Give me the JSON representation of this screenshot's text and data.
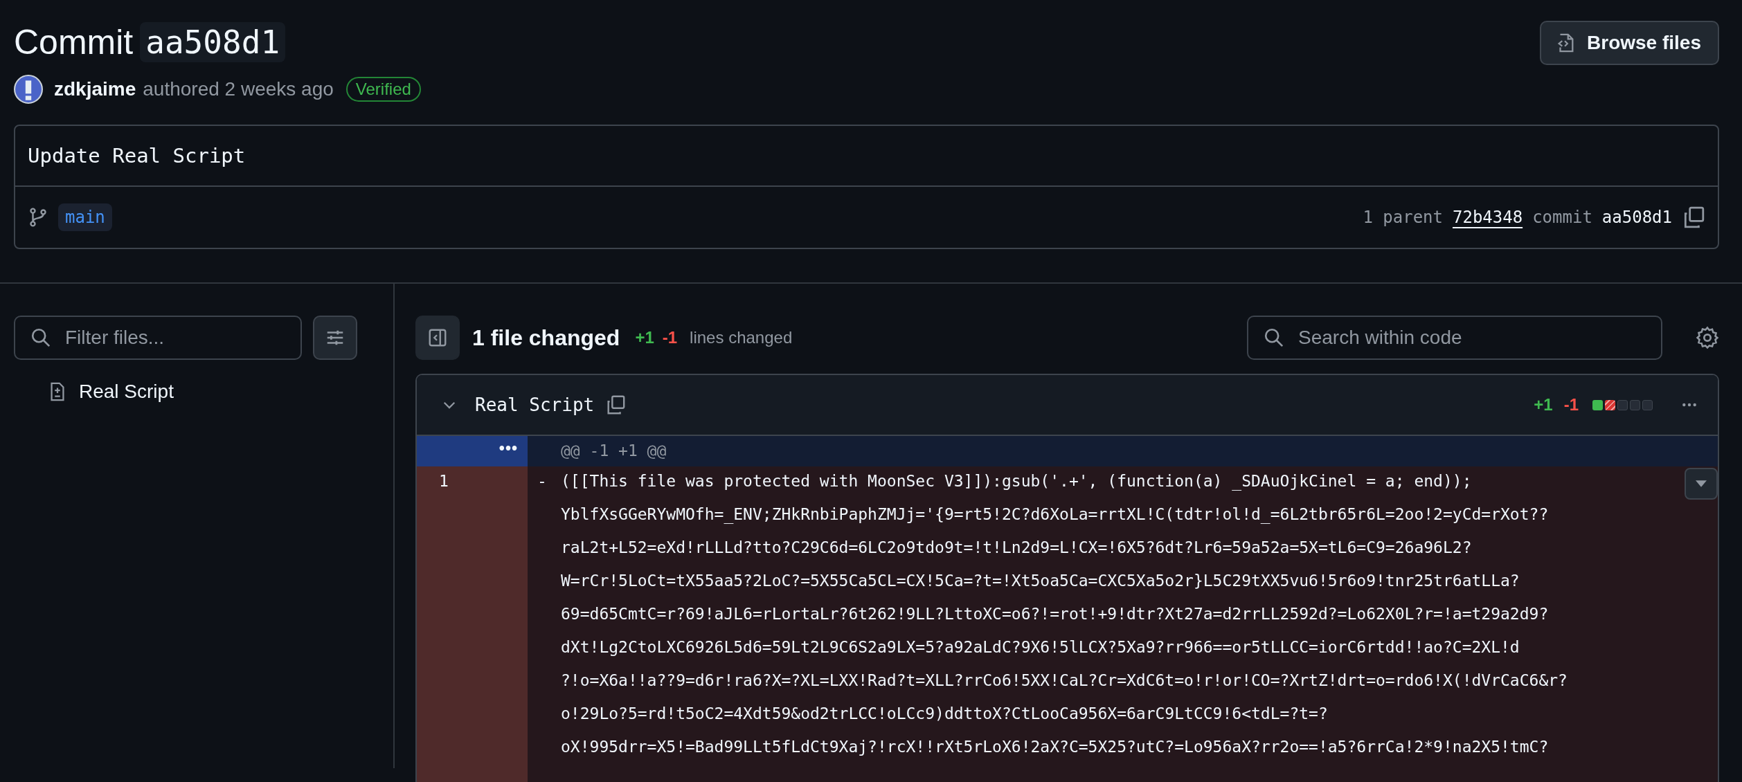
{
  "header": {
    "title": "Commit",
    "sha": "aa508d1",
    "browse_button": "Browse files"
  },
  "meta": {
    "author": "zdkjaime",
    "action": "authored 2 weeks ago",
    "badge": "Verified"
  },
  "message": {
    "title": "Update Real Script",
    "branch": "main",
    "parent_label": "1 parent",
    "parent_sha": "72b4348",
    "commit_label": "commit",
    "commit_sha": "aa508d1"
  },
  "sidebar": {
    "filter": {
      "placeholder": "Filter files..."
    },
    "files": [
      {
        "name": "Real Script",
        "selected": false
      }
    ]
  },
  "toolbar": {
    "summary": "1 file changed",
    "additions": "+1",
    "deletions": "-1",
    "suffix": "lines changed",
    "search": {
      "placeholder": "Search within code"
    }
  },
  "file": {
    "name": "Real Script",
    "additions": "+1",
    "deletions": "-1",
    "diffstat": [
      {
        "kind": "added"
      },
      {
        "kind": "deleted"
      },
      {
        "kind": "neutral"
      },
      {
        "kind": "neutral"
      },
      {
        "kind": "neutral"
      }
    ],
    "hunk": {
      "expander": "•••",
      "header": "@@ -1 +1 @@"
    },
    "lines": [
      {
        "kind": "deletion",
        "number": "1",
        "sign": "-",
        "wrapped": [
          "([[This file was protected with MoonSec V3]]):gsub('.+', (function(a) _SDAuOjkCinel = a; end));",
          "YblfXsGGeRYwMOfh=_ENV;ZHkRnbiPaphZMJj='{9=rt5!2C?d6XoLa=rrtXL!C(tdtr!ol!d_=6L2tbr65r6L=2oo!2=yCd=rXot??",
          "raL2t+L52=eXd!rLLLd?tto?C29C6d=6LC2o9tdo9t=!t!Ln2d9=L!CX=!6X5?6dt?Lr6=59a52a=5X=tL6=C9=26a96L2?",
          "W=rCr!5LoCt=tX55aa5?2LoC?=5X55Ca5CL=CX!5Ca=?t=!Xt5oa5Ca=CXC5Xa5o2r}L5C29tXX5vu6!5r6o9!tnr25tr6atLLa?",
          "69=d65CmtC=r?69!aJL6=rLortaLr?6t262!9LL?LttoXC=o6?!=rot!+9!dtr?Xt27a=d2rrLL2592d?=Lo62X0L?r=!a=t29a2d9?",
          "dXt!Lg2CtoLXC6926L5d6=59Lt2L9C6S2a9LX=5?a92aLdC?9X6!5lLCX?5Xa9?rr966==or5tLLCC=iorC6rtdd!!ao?C=2XL!d",
          "?!o=X6a!!a??9=d6r!ra6?X=?XL=LXX!Rad?t=XLL?rrCo6!5XX!CaL?Cr=XdC6t=o!r!or!CO=?XrtZ!drt=o=rdo6!X(!dVrCaC6&r?",
          "o!29Lo?5=rd!t5oC2=4Xdt59&od2trLCC!oLCc9)ddttoX?CtLooCa956X=6arC9LtCC9!6<tdL=?t=?",
          "oX!995drr=X5!=Bad99LLt5fLdCt9Xaj?!rcX!!rXt5rLoX6!2aX?C=5X25?utC?=Lo956aX?rr2o==!a5?6rrCa!2*9!na2X5!tmC?"
        ]
      }
    ]
  }
}
